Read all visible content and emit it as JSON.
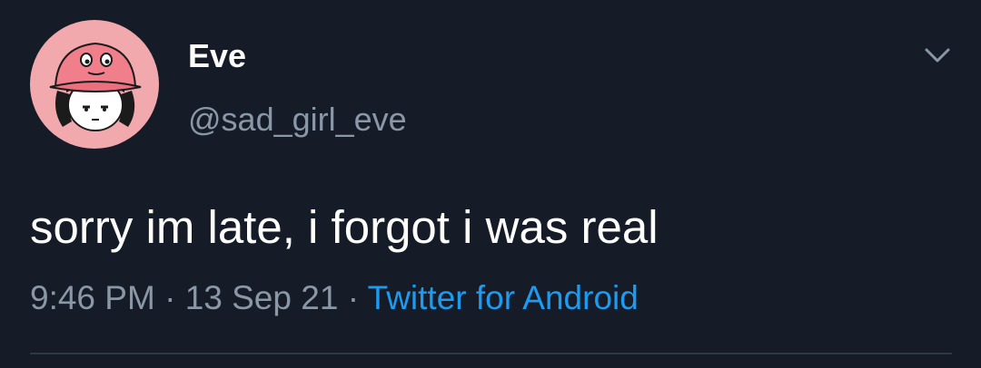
{
  "tweet": {
    "author": {
      "display_name": "Eve",
      "handle": "@sad_girl_eve",
      "avatar_icon": "avatar-cartoon-girl-pink-hat"
    },
    "text": "sorry im late, i forgot i was real",
    "time": "9:46 PM",
    "separator": "·",
    "date": "13 Sep 21",
    "source": "Twitter for Android",
    "menu_icon": "chevron-down-icon"
  },
  "colors": {
    "background": "#151c27",
    "text_primary": "#ffffff",
    "text_secondary": "#8a97a6",
    "link": "#1d9bf0",
    "avatar_bg": "#f2a9ae"
  }
}
